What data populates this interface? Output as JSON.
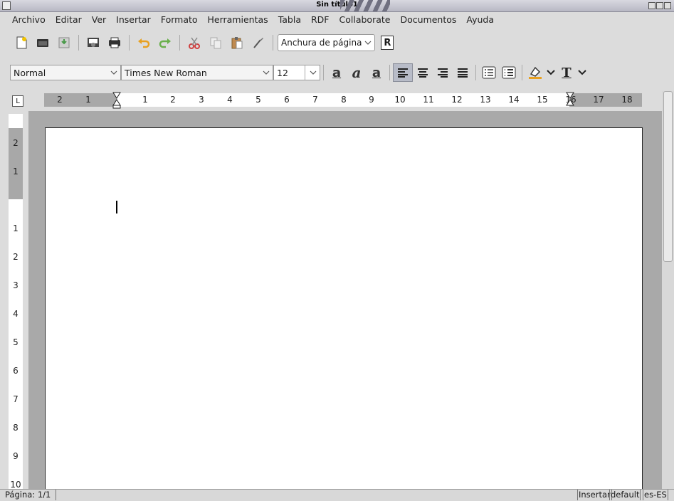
{
  "window": {
    "title": "Sin título1"
  },
  "menu": [
    "Archivo",
    "Editar",
    "Ver",
    "Insertar",
    "Formato",
    "Herramientas",
    "Tabla",
    "RDF",
    "Collaborate",
    "Documentos",
    "Ayuda"
  ],
  "toolbar": {
    "zoom_value": "Anchura de página",
    "r_label": "R"
  },
  "formatting": {
    "style": "Normal",
    "font": "Times New Roman",
    "size": "12",
    "bold_glyph": "a",
    "italic_glyph": "a",
    "underline_glyph": "a",
    "text_color_glyph": "T"
  },
  "ruler": {
    "h_left": [
      "2",
      "1"
    ],
    "h_right": [
      "1",
      "2",
      "3",
      "4",
      "5",
      "6",
      "7",
      "8",
      "9",
      "10",
      "11",
      "12",
      "13",
      "14",
      "15",
      "16",
      "17",
      "18"
    ],
    "v_top": [
      "2",
      "1"
    ],
    "v_bottom": [
      "1",
      "2",
      "3",
      "4",
      "5",
      "6",
      "7",
      "8",
      "9",
      "10"
    ],
    "corner_glyph": "L"
  },
  "status": {
    "page": "Página: 1/1",
    "mode": "Insertar",
    "style": "default",
    "lang": "es-ES"
  },
  "colors": {
    "workspace": "#a9a9a9",
    "page": "#ffffff",
    "accent_orange": "#e8a020"
  }
}
